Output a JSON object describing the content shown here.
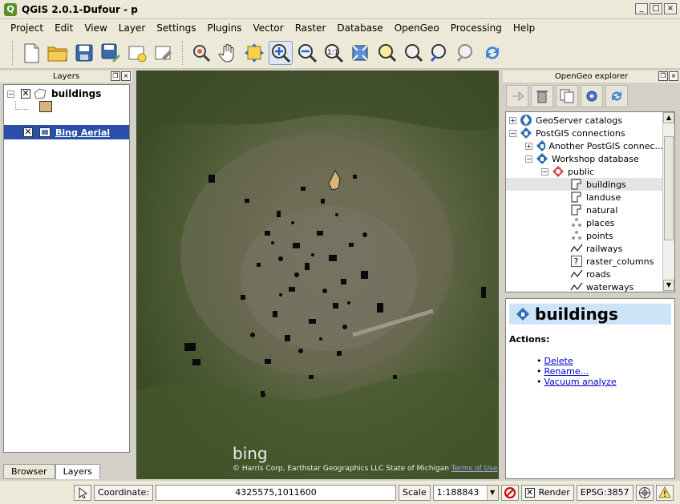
{
  "window": {
    "title": "QGIS 2.0.1-Dufour - p",
    "app_icon_letter": "Q",
    "minimize": "_",
    "maximize": "□",
    "close": "×"
  },
  "menu": [
    "Project",
    "Edit",
    "View",
    "Layer",
    "Settings",
    "Plugins",
    "Vector",
    "Raster",
    "Database",
    "OpenGeo",
    "Processing",
    "Help"
  ],
  "toolbar": {
    "icons": [
      "new-project-icon",
      "open-project-icon",
      "save-project-icon",
      "save-as-icon",
      "new-print-composer-icon",
      "composer-manager-icon",
      "touch-zoom-icon",
      "pan-icon",
      "pan-to-selection-icon",
      "zoom-in-icon",
      "zoom-out-icon",
      "zoom-actual-size-icon",
      "zoom-full-icon",
      "zoom-to-selection-icon",
      "zoom-to-layer-icon",
      "zoom-last-icon",
      "zoom-next-icon",
      "refresh-icon"
    ],
    "active_tool": "zoom-in-icon"
  },
  "layers_panel": {
    "title": "Layers",
    "layers": [
      {
        "name": "buildings",
        "checked": true,
        "selected": false
      },
      {
        "name": "Bing Aerial",
        "checked": true,
        "selected": true
      }
    ],
    "tabs": [
      "Browser",
      "Layers"
    ],
    "active_tab": "Layers"
  },
  "map": {
    "logo": "bing",
    "copyright": "© Harris Corp, Earthstar Geographics LLC State of Michigan",
    "terms_link": "Terms of Use"
  },
  "explorer": {
    "title": "OpenGeo explorer",
    "toolbar_icons": [
      "publish-icon",
      "delete-icon",
      "copy-icon",
      "settings-icon",
      "refresh-icon"
    ],
    "tree": [
      {
        "label": "GeoServer catalogs",
        "depth": 0,
        "toggle": "+",
        "icon": "geoserver-icon"
      },
      {
        "label": "PostGIS connections",
        "depth": 0,
        "toggle": "−",
        "icon": "postgis-icon"
      },
      {
        "label": "Another PostGIS connec...",
        "depth": 1,
        "toggle": "+",
        "icon": "postgis-icon"
      },
      {
        "label": "Workshop database",
        "depth": 1,
        "toggle": "−",
        "icon": "postgis-icon"
      },
      {
        "label": "public",
        "depth": 2,
        "toggle": "−",
        "icon": "schema-icon"
      },
      {
        "label": "buildings",
        "depth": 3,
        "toggle": "",
        "icon": "polygon-icon",
        "selected": true
      },
      {
        "label": "landuse",
        "depth": 3,
        "toggle": "",
        "icon": "polygon-icon"
      },
      {
        "label": "natural",
        "depth": 3,
        "toggle": "",
        "icon": "polygon-icon"
      },
      {
        "label": "places",
        "depth": 3,
        "toggle": "",
        "icon": "point-icon"
      },
      {
        "label": "points",
        "depth": 3,
        "toggle": "",
        "icon": "point-icon"
      },
      {
        "label": "railways",
        "depth": 3,
        "toggle": "",
        "icon": "line-icon"
      },
      {
        "label": "raster_columns",
        "depth": 3,
        "toggle": "",
        "icon": "unknown-icon"
      },
      {
        "label": "roads",
        "depth": 3,
        "toggle": "",
        "icon": "line-icon"
      },
      {
        "label": "waterways",
        "depth": 3,
        "toggle": "",
        "icon": "line-icon"
      }
    ],
    "detail": {
      "title": "buildings",
      "actions_label": "Actions:",
      "actions": [
        "Delete",
        "Rename...",
        "Vacuum analyze"
      ]
    }
  },
  "statusbar": {
    "coordinate_label": "Coordinate:",
    "coordinate_value": "4325575,1011600",
    "scale_label": "Scale",
    "scale_value": "1:188843",
    "render_label": "Render",
    "render_checked": true,
    "crs": "EPSG:3857"
  }
}
